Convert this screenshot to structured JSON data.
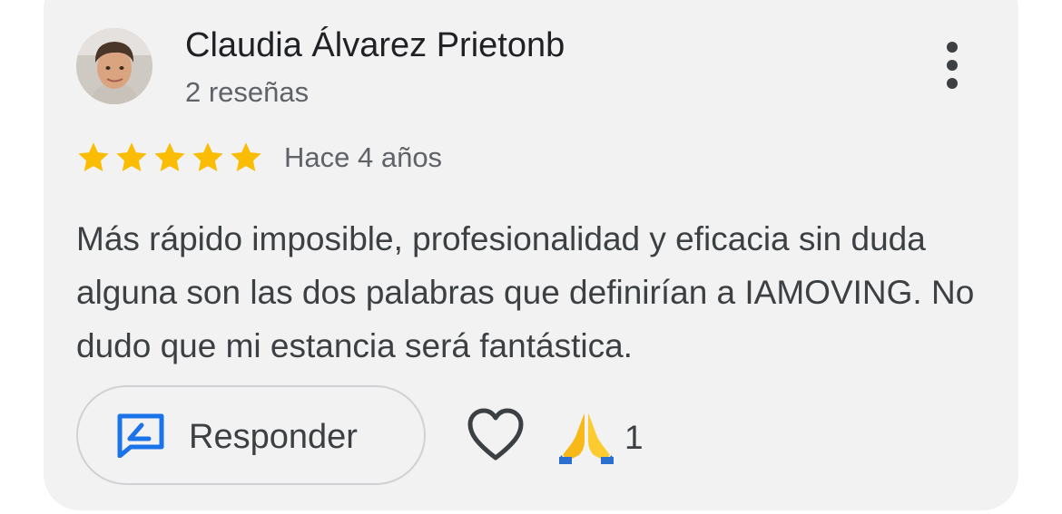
{
  "review": {
    "author_name": "Claudia Álvarez Prietonb",
    "author_reviews": "2 reseñas",
    "rating": 5,
    "rating_max": 5,
    "date": "Hace 4 años",
    "text": "Más rápido imposible, profesionalidad y eficacia sin duda alguna son las dos palabras que definirían a IAMOVING. No dudo que mi estancia será fantástica."
  },
  "actions": {
    "reply_label": "Responder",
    "reaction_count": "1"
  },
  "icons": {
    "avatar": "avatar",
    "more": "more-vertical-icon",
    "star": "star-icon",
    "reply": "reply-icon",
    "like": "heart-icon",
    "reaction": "folded-hands-icon"
  },
  "colors": {
    "card_background": "#f2f2f2",
    "star": "#fbbc04",
    "reply_icon": "#1a73e8",
    "text_primary": "#202124",
    "text_secondary": "#5f6368"
  }
}
